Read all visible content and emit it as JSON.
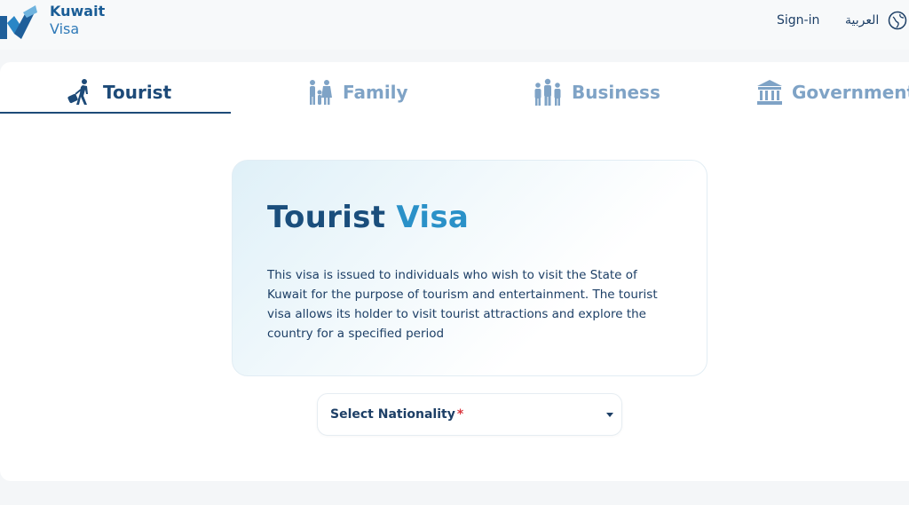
{
  "header": {
    "brand_line1": "Kuwait",
    "brand_line2": "Visa",
    "signin_label": "Sign-in",
    "language_label": "العربية",
    "icons": [
      "kuwait-visa-logo",
      "globe-icon"
    ]
  },
  "tabs": [
    {
      "label": "Tourist",
      "icon": "traveler-icon",
      "active": true
    },
    {
      "label": "Family",
      "icon": "family-icon",
      "active": false
    },
    {
      "label": "Business",
      "icon": "business-people-icon",
      "active": false
    },
    {
      "label": "Government",
      "icon": "government-building-icon",
      "active": false
    }
  ],
  "visa_info": {
    "title_part1": "Tourist",
    "title_part2": "Visa",
    "description": "This visa is issued to individuals who wish to visit the State of Kuwait for the purpose of tourism and entertainment. The tourist visa allows its holder to visit tourist attractions and explore the country for a specified period"
  },
  "nationality_select": {
    "label": "Select Nationality",
    "required_mark": "*"
  },
  "colors": {
    "primary": "#1d4a78",
    "accent": "#2a91c8",
    "inactive_tab": "#7fa3c6",
    "required": "#d9363e"
  }
}
